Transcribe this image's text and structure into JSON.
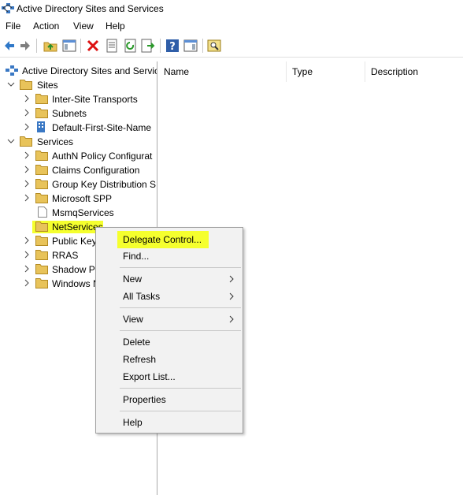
{
  "window": {
    "title": "Active Directory Sites and Services"
  },
  "menubar": {
    "items": [
      "File",
      "Action",
      "View",
      "Help"
    ]
  },
  "toolbar": {
    "buttons": [
      "back-icon",
      "forward-icon",
      "up-folder-icon",
      "show-hide-tree-icon",
      "delete-icon",
      "properties-icon",
      "refresh-icon",
      "export-list-icon",
      "help-icon",
      "action-pane-icon",
      "find-icon"
    ]
  },
  "tree": {
    "root": "Active Directory Sites and Servic",
    "sites": "Sites",
    "inter_site": "Inter-Site Transports",
    "subnets": "Subnets",
    "default_site": "Default-First-Site-Name",
    "services": "Services",
    "authn": "AuthN Policy Configurat",
    "claims": "Claims Configuration",
    "group_key": "Group Key Distribution S",
    "ms_spp": "Microsoft SPP",
    "msmq": "MsmqServices",
    "netservices": "NetServices",
    "public_key": "Public Key",
    "rras": "RRAS",
    "shadow": "Shadow Pr",
    "windows": "Windows N"
  },
  "details": {
    "columns": [
      "Name",
      "Type",
      "Description"
    ]
  },
  "context_menu": {
    "delegate": "Delegate Control...",
    "find": "Find...",
    "new": "New",
    "all_tasks": "All Tasks",
    "view": "View",
    "delete": "Delete",
    "refresh": "Refresh",
    "export": "Export List...",
    "properties": "Properties",
    "help": "Help"
  },
  "colors": {
    "highlight": "#f5ff2e",
    "folder": "#e8c35a",
    "menu_bg": "#f2f2f2"
  }
}
